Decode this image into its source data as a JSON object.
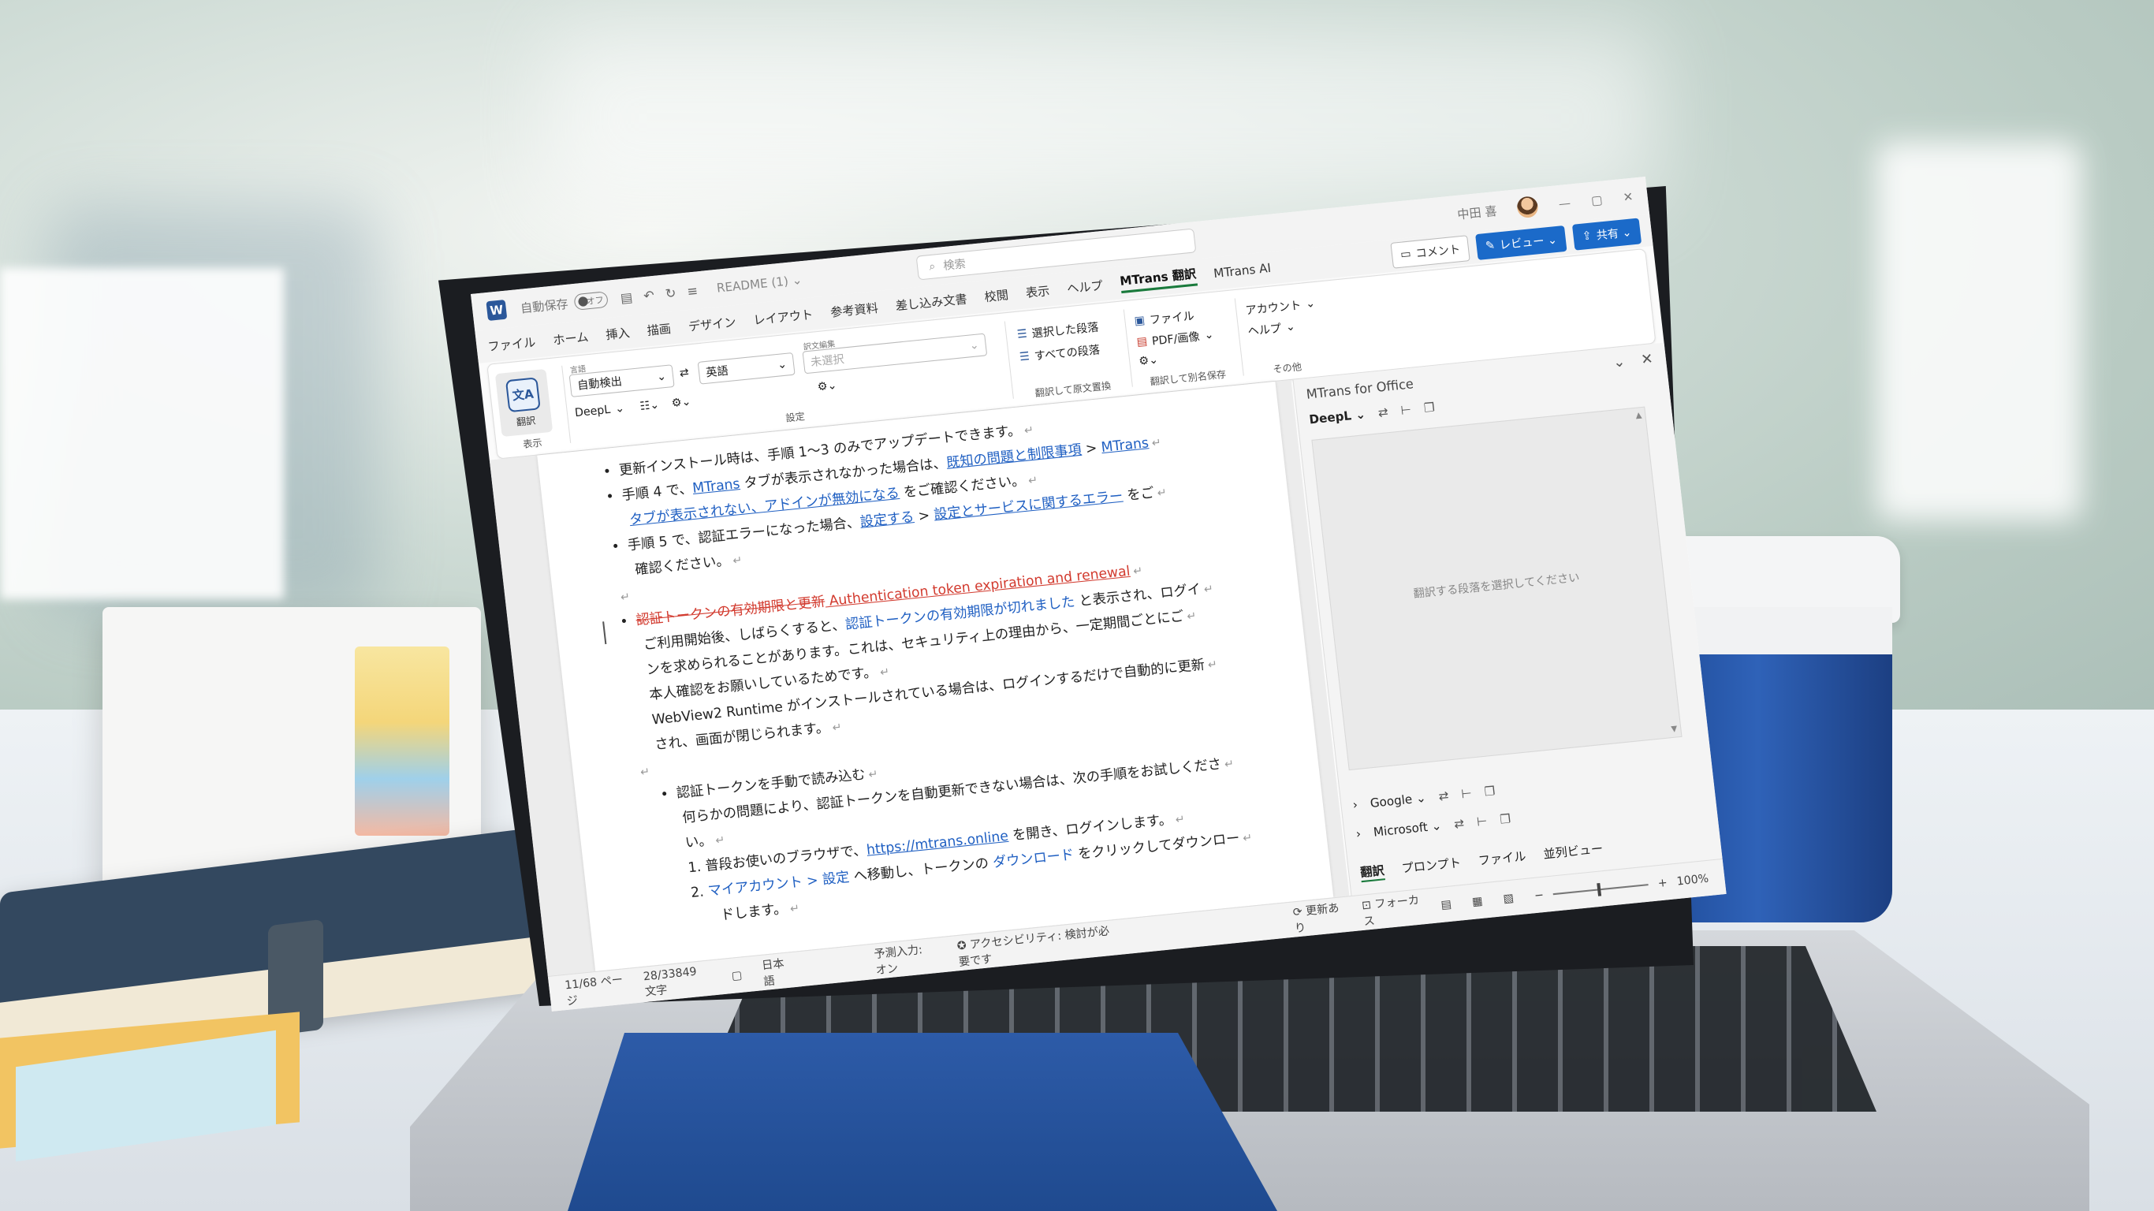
{
  "titlebar": {
    "logo": "W",
    "autosave_label": "自動保存",
    "autosave_state": "オフ",
    "doc_name": "README (1) ⌄",
    "search_placeholder": "検索",
    "user": "中田 喜",
    "min": "—",
    "restore": "▢",
    "close": "✕"
  },
  "tabs": {
    "items": [
      "ファイル",
      "ホーム",
      "挿入",
      "描画",
      "デザイン",
      "レイアウト",
      "参考資料",
      "差し込み文書",
      "校閲",
      "表示",
      "ヘルプ",
      "MTrans 翻訳",
      "MTrans AI"
    ],
    "active_index": 11,
    "comment": "コメント",
    "review": "レビュー ⌄",
    "share": "共有 ⌄"
  },
  "ribbon": {
    "translate_btn": "翻訳",
    "translate_icon": "translate-icon",
    "group_show": "表示",
    "label_lang": "言語",
    "source_lang": "自動検出",
    "target_lang": "英語",
    "engine": "DeepL",
    "label_glossary": "訳文編集",
    "glossary_value": "未選択",
    "group_settings": "設定",
    "selected_para": "選択した段落",
    "all_para": "すべての段落",
    "group_replace": "翻訳して原文置換",
    "file": "ファイル",
    "pdf_image": "PDF/画像",
    "group_save": "翻訳して別名保存",
    "account": "アカウント",
    "help": "ヘルプ",
    "group_other": "その他"
  },
  "document": {
    "lines": [
      {
        "type": "b",
        "segs": [
          {
            "t": "更新インストール時は、手順 1～3 のみでアップデートできます。"
          }
        ]
      },
      {
        "type": "b",
        "segs": [
          {
            "t": "手順 4 で、"
          },
          {
            "t": "MTrans",
            "c": "link"
          },
          {
            "t": " タブが表示されなかった場合は、"
          },
          {
            "t": "既知の問題と制限事項",
            "c": "link"
          },
          {
            "t": " > "
          },
          {
            "t": "MTrans",
            "c": "link"
          }
        ]
      },
      {
        "type": "c",
        "segs": [
          {
            "t": "タブが表示されない、アドインが無効になる",
            "c": "link"
          },
          {
            "t": " をご確認ください。"
          }
        ]
      },
      {
        "type": "b",
        "segs": [
          {
            "t": "手順 5 で、認証エラーになった場合、"
          },
          {
            "t": "設定する",
            "c": "link"
          },
          {
            "t": " > "
          },
          {
            "t": "設定とサービスに関するエラー",
            "c": "link"
          },
          {
            "t": " をご"
          }
        ]
      },
      {
        "type": "c",
        "segs": [
          {
            "t": "確認ください。"
          }
        ]
      },
      {
        "type": "e",
        "segs": []
      },
      {
        "type": "b",
        "segs": [
          {
            "t": "認証トークンの有効期限と更新",
            "c": "del"
          },
          {
            "t": " Authentication token expiration and renewal",
            "c": "ins"
          }
        ]
      },
      {
        "type": "c",
        "segs": [
          {
            "t": "ご利用開始後、しばらくすると、"
          },
          {
            "t": "認証トークンの有効期限が切れました",
            "c": "link-plain"
          },
          {
            "t": " と表示され、ログイ"
          }
        ]
      },
      {
        "type": "c",
        "segs": [
          {
            "t": "ンを求められることがあります。これは、セキュリティ上の理由から、一定期間ごとにご"
          }
        ]
      },
      {
        "type": "c",
        "segs": [
          {
            "t": "本人確認をお願いしているためです。"
          }
        ]
      },
      {
        "type": "c",
        "segs": [
          {
            "t": "WebView2 Runtime がインストールされている場合は、ログインするだけで自動的に更新"
          }
        ]
      },
      {
        "type": "c",
        "segs": [
          {
            "t": "され、画面が閉じられます。"
          }
        ]
      },
      {
        "type": "e",
        "segs": []
      },
      {
        "type": "b2",
        "segs": [
          {
            "t": "認証トークンを手動で読み込む"
          }
        ]
      },
      {
        "type": "c2",
        "segs": [
          {
            "t": "何らかの問題により、認証トークンを自動更新できない場合は、次の手順をお試しくださ"
          }
        ]
      },
      {
        "type": "c2",
        "segs": [
          {
            "t": "い。"
          }
        ]
      },
      {
        "type": "n",
        "segs": [
          {
            "t": "1.  普段お使いのブラウザで、"
          },
          {
            "t": "https://mtrans.online",
            "c": "link"
          },
          {
            "t": " を開き、ログインします。"
          }
        ]
      },
      {
        "type": "n",
        "segs": [
          {
            "t": "2.  "
          },
          {
            "t": "マイアカウント > 設定",
            "c": "link-plain"
          },
          {
            "t": " へ移動し、トークンの "
          },
          {
            "t": "ダウンロード",
            "c": "link-plain"
          },
          {
            "t": " をクリックしてダウンロー"
          }
        ]
      },
      {
        "type": "c3",
        "segs": [
          {
            "t": "ドします。"
          }
        ]
      }
    ]
  },
  "panel": {
    "title": "MTrans for Office",
    "engine_main": "DeepL ⌄",
    "hint": "翻訳する段落を選択してください",
    "engine_google": "Google ⌄",
    "engine_microsoft": "Microsoft ⌄",
    "tabs": [
      "翻訳",
      "プロンプト",
      "ファイル",
      "並列ビュー"
    ]
  },
  "statusbar": {
    "page": "11/68 ページ",
    "words": "28/33849 文字",
    "language": "日本語",
    "predict": "予測入力: オン",
    "accessibility": "アクセシビリティ: 検討が必要です",
    "update": "更新あり",
    "focus": "フォーカス",
    "zoom": "100%"
  }
}
